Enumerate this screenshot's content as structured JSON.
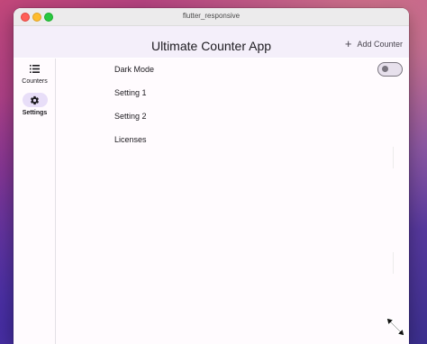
{
  "window": {
    "title": "flutter_responsive"
  },
  "appbar": {
    "title": "Ultimate Counter App",
    "add_label": "Add Counter",
    "add_icon": "plus-icon"
  },
  "rail": {
    "items": [
      {
        "label": "Counters",
        "icon": "list-icon",
        "selected": false
      },
      {
        "label": "Settings",
        "icon": "gear-icon",
        "selected": true
      }
    ]
  },
  "settings": {
    "items": [
      {
        "label": "Dark Mode",
        "toggle": false
      },
      {
        "label": "Setting 1"
      },
      {
        "label": "Setting 2"
      },
      {
        "label": "Licenses"
      }
    ]
  },
  "colors": {
    "appbar_bg": "#f4effa",
    "selected_indicator": "#e8def8",
    "toggle_outline": "#79747e"
  }
}
